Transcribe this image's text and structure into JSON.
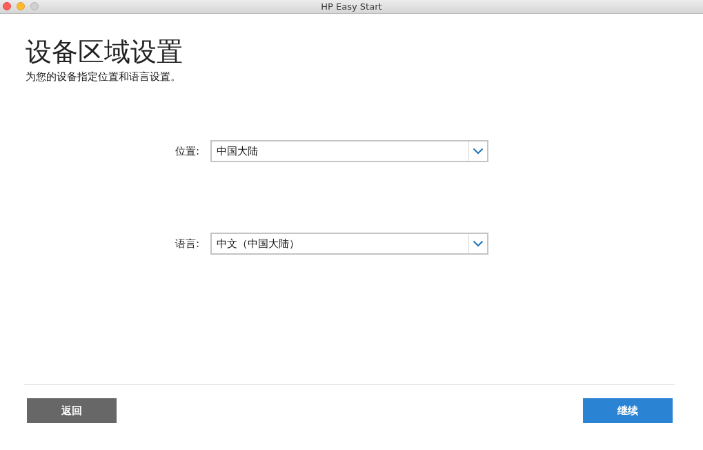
{
  "window": {
    "title": "HP Easy Start"
  },
  "heading": "设备区域设置",
  "subtitle": "为您的设备指定位置和语言设置。",
  "fields": [
    {
      "label": "位置:",
      "value": "中国大陆"
    },
    {
      "label": "语言:",
      "value": "中文（中国大陆）"
    }
  ],
  "buttons": [
    {
      "label": "返回",
      "kind": "secondary"
    },
    {
      "label": "继续",
      "kind": "primary"
    }
  ]
}
